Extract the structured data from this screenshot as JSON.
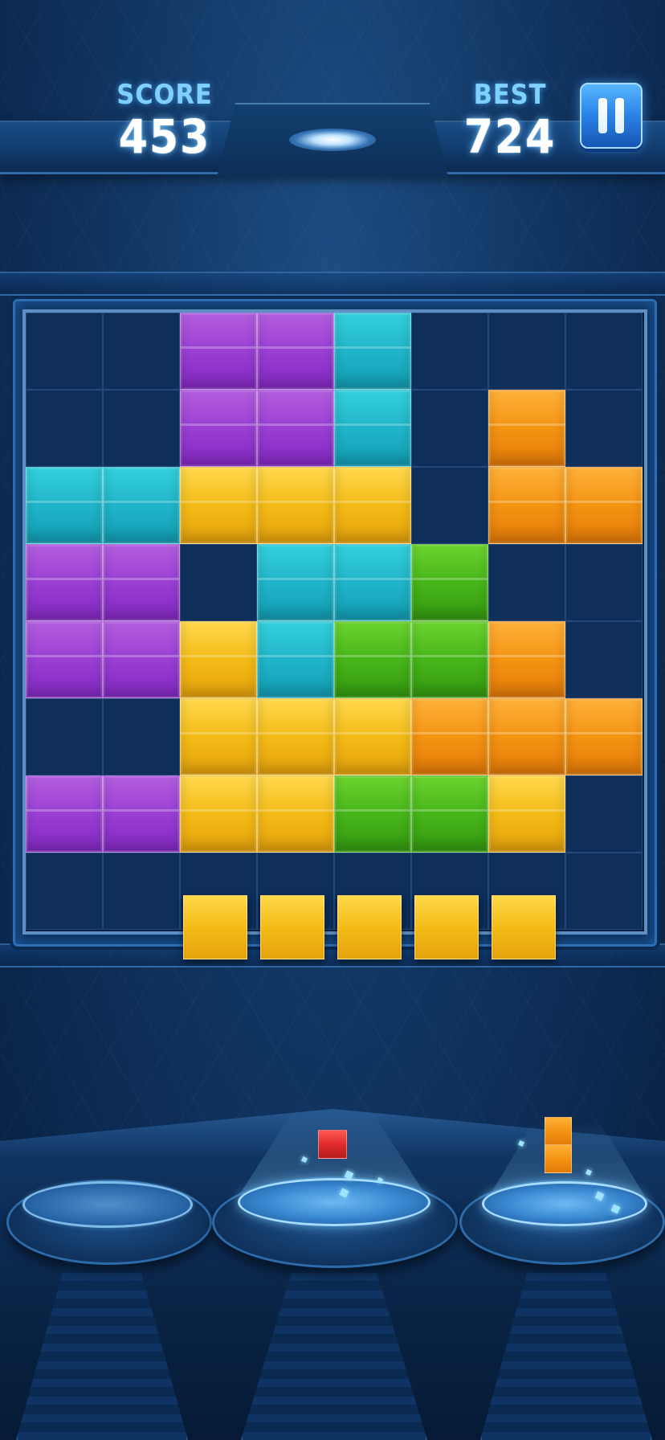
{
  "hud": {
    "score_label": "SCORE",
    "score_value": "453",
    "best_label": "BEST",
    "best_value": "724"
  },
  "colors": {
    "purple": "#9a3fd1",
    "cyan": "#1fb5c8",
    "yellow": "#f4bb17",
    "orange": "#f39412",
    "green": "#47b61a",
    "red": "#e12b2b",
    "board": "#0f2e5a"
  },
  "board": {
    "rows": 8,
    "cols": 8,
    "grid": [
      [
        ".",
        ".",
        "P",
        "P",
        "C",
        ".",
        ".",
        "."
      ],
      [
        ".",
        ".",
        "P",
        "P",
        "C",
        ".",
        "O",
        "."
      ],
      [
        "C",
        "C",
        "Y",
        "Y",
        "Y",
        ".",
        "O",
        "O"
      ],
      [
        "P",
        "P",
        ".",
        "C",
        "C",
        "G",
        ".",
        "."
      ],
      [
        "P",
        "P",
        "Y",
        "C",
        "G",
        "G",
        "O",
        "."
      ],
      [
        ".",
        ".",
        "Y",
        "Y",
        "Y",
        "O",
        "O",
        "O"
      ],
      [
        "P",
        "P",
        "Y",
        "Y",
        "G",
        "G",
        "Y",
        "."
      ],
      [
        ".",
        ".",
        ".",
        ".",
        ".",
        ".",
        ".",
        "."
      ]
    ]
  },
  "dragging_piece": {
    "color": "Y",
    "length": 5,
    "orientation": "horizontal"
  },
  "tray": {
    "slots": [
      {
        "piece": null
      },
      {
        "piece": {
          "color": "R",
          "cells": 1
        }
      },
      {
        "piece": {
          "color": "O",
          "cells": 2,
          "orientation": "vertical"
        }
      }
    ]
  },
  "icons": {
    "pause": "pause-icon"
  }
}
